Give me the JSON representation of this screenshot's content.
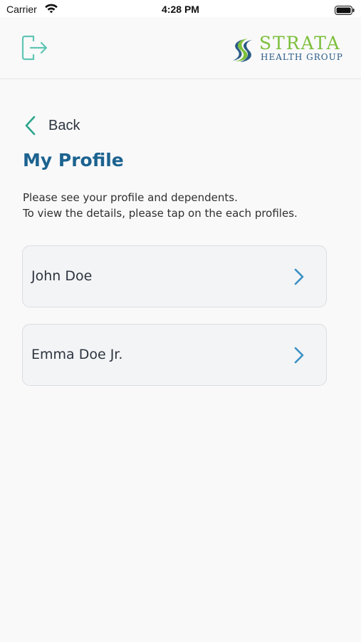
{
  "status_bar": {
    "carrier": "Carrier",
    "time": "4:28 PM"
  },
  "header": {
    "logo_text": "STRATA",
    "logo_subtext": "HEALTH GROUP",
    "logout_icon": "logout-icon"
  },
  "nav": {
    "back_label": "Back"
  },
  "page": {
    "title": "My Profile",
    "intro_line1": "Please see your profile and dependents.",
    "intro_line2": "To view the details, please tap on the each profiles."
  },
  "profiles": [
    {
      "name": "John Doe"
    },
    {
      "name": "Emma Doe Jr."
    }
  ],
  "colors": {
    "accent_teal": "#2aa58a",
    "title_blue": "#1c6390",
    "chevron_blue": "#3a8fc7",
    "logo_green": "#7cbf3a",
    "logo_navy": "#2a5b84"
  }
}
